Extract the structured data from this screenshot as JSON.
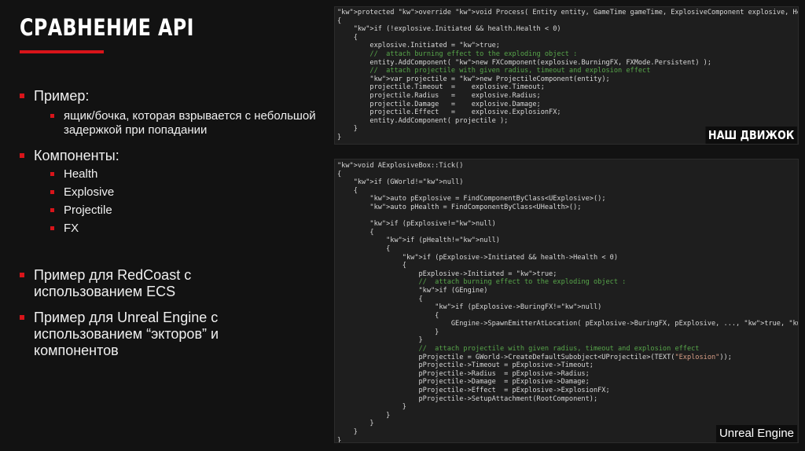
{
  "slide": {
    "title": "СРАВНЕНИЕ API",
    "bullets": [
      {
        "level": 1,
        "text": "Пример:"
      },
      {
        "level": 2,
        "text": "ящик/бочка, которая взрывается с небольшой задержкой при попадании"
      },
      {
        "level": 1,
        "text": "Компоненты:"
      },
      {
        "level": 2,
        "text": "Health"
      },
      {
        "level": 2,
        "text": "Explosive"
      },
      {
        "level": 2,
        "text": "Projectile"
      },
      {
        "level": 2,
        "text": "FX"
      },
      {
        "level": 1,
        "text": "Пример для RedCoast с использованием ECS"
      },
      {
        "level": 1,
        "text": "Пример для Unreal Engine с использованием “экторов” и компонентов"
      }
    ]
  },
  "code_top": {
    "label": "НАШ ДВИЖОК",
    "lines": [
      "protected override void Process( Entity entity, GameTime gameTime, ExplosiveComponent explosive, HealthComponent health )",
      "{",
      "    if (!explosive.Initiated && health.Health < 0)",
      "    {",
      "        explosive.Initiated = true;",
      "        //  attach burning effect to the exploding object :",
      "        entity.AddComponent( new FXComponent(explosive.BurningFX, FXMode.Persistent) );",
      "        //  attach projectile with given radius, timeout and explosion effect",
      "        var projectile = new ProjectileComponent(entity);",
      "        projectile.Timeout  =    explosive.Timeout;",
      "        projectile.Radius   =    explosive.Radius;",
      "        projectile.Damage   =    explosive.Damage;",
      "        projectile.Effect   =    explosive.ExplosionFX;",
      "        entity.AddComponent( projectile );",
      "    }",
      "}"
    ]
  },
  "code_bottom": {
    "label": "Unreal Engine",
    "lines": [
      "void AExplosiveBox::Tick()",
      "{",
      "    if (GWorld!=null)",
      "    {",
      "        auto pExplosive = FindComponentByClass<UExplosive>();",
      "        auto pHealth = FindComponentByClass<UHealth>();",
      "",
      "        if (pExplosive!=null)",
      "        {",
      "            if (pHealth!=null)",
      "            {",
      "                if (pExplosive->Initiated && health->Health < 0)",
      "                {",
      "                    pExplosive->Initiated = true;",
      "                    //  attach burning effect to the exploding object :",
      "                    if (GEngine)",
      "                    {",
      "                        if (pExplosive->BuringFX!=null)",
      "                        {",
      "                            GEngine->SpawnEmitterAtLocation( pExplosive->BuringFX, pExplosive, ..., true, true);",
      "                        }",
      "                    }",
      "                    //  attach projectile with given radius, timeout and explosion effect",
      "                    pProjectile = GWorld->CreateDefaultSubobject<UProjectile>(TEXT(\"Explosion\"));",
      "                    pProjectile->Timeout = pExplosive->Timeout;",
      "                    pProjectile->Radius  = pExplosive->Radius;",
      "                    pProjectile->Damage  = pExplosive->Damage;",
      "                    pProjectile->Effect  = pExplosive->ExplosionFX;",
      "                    pProjectile->SetupAttachment(RootComponent);",
      "                }",
      "            }",
      "        }",
      "    }",
      "}"
    ]
  }
}
